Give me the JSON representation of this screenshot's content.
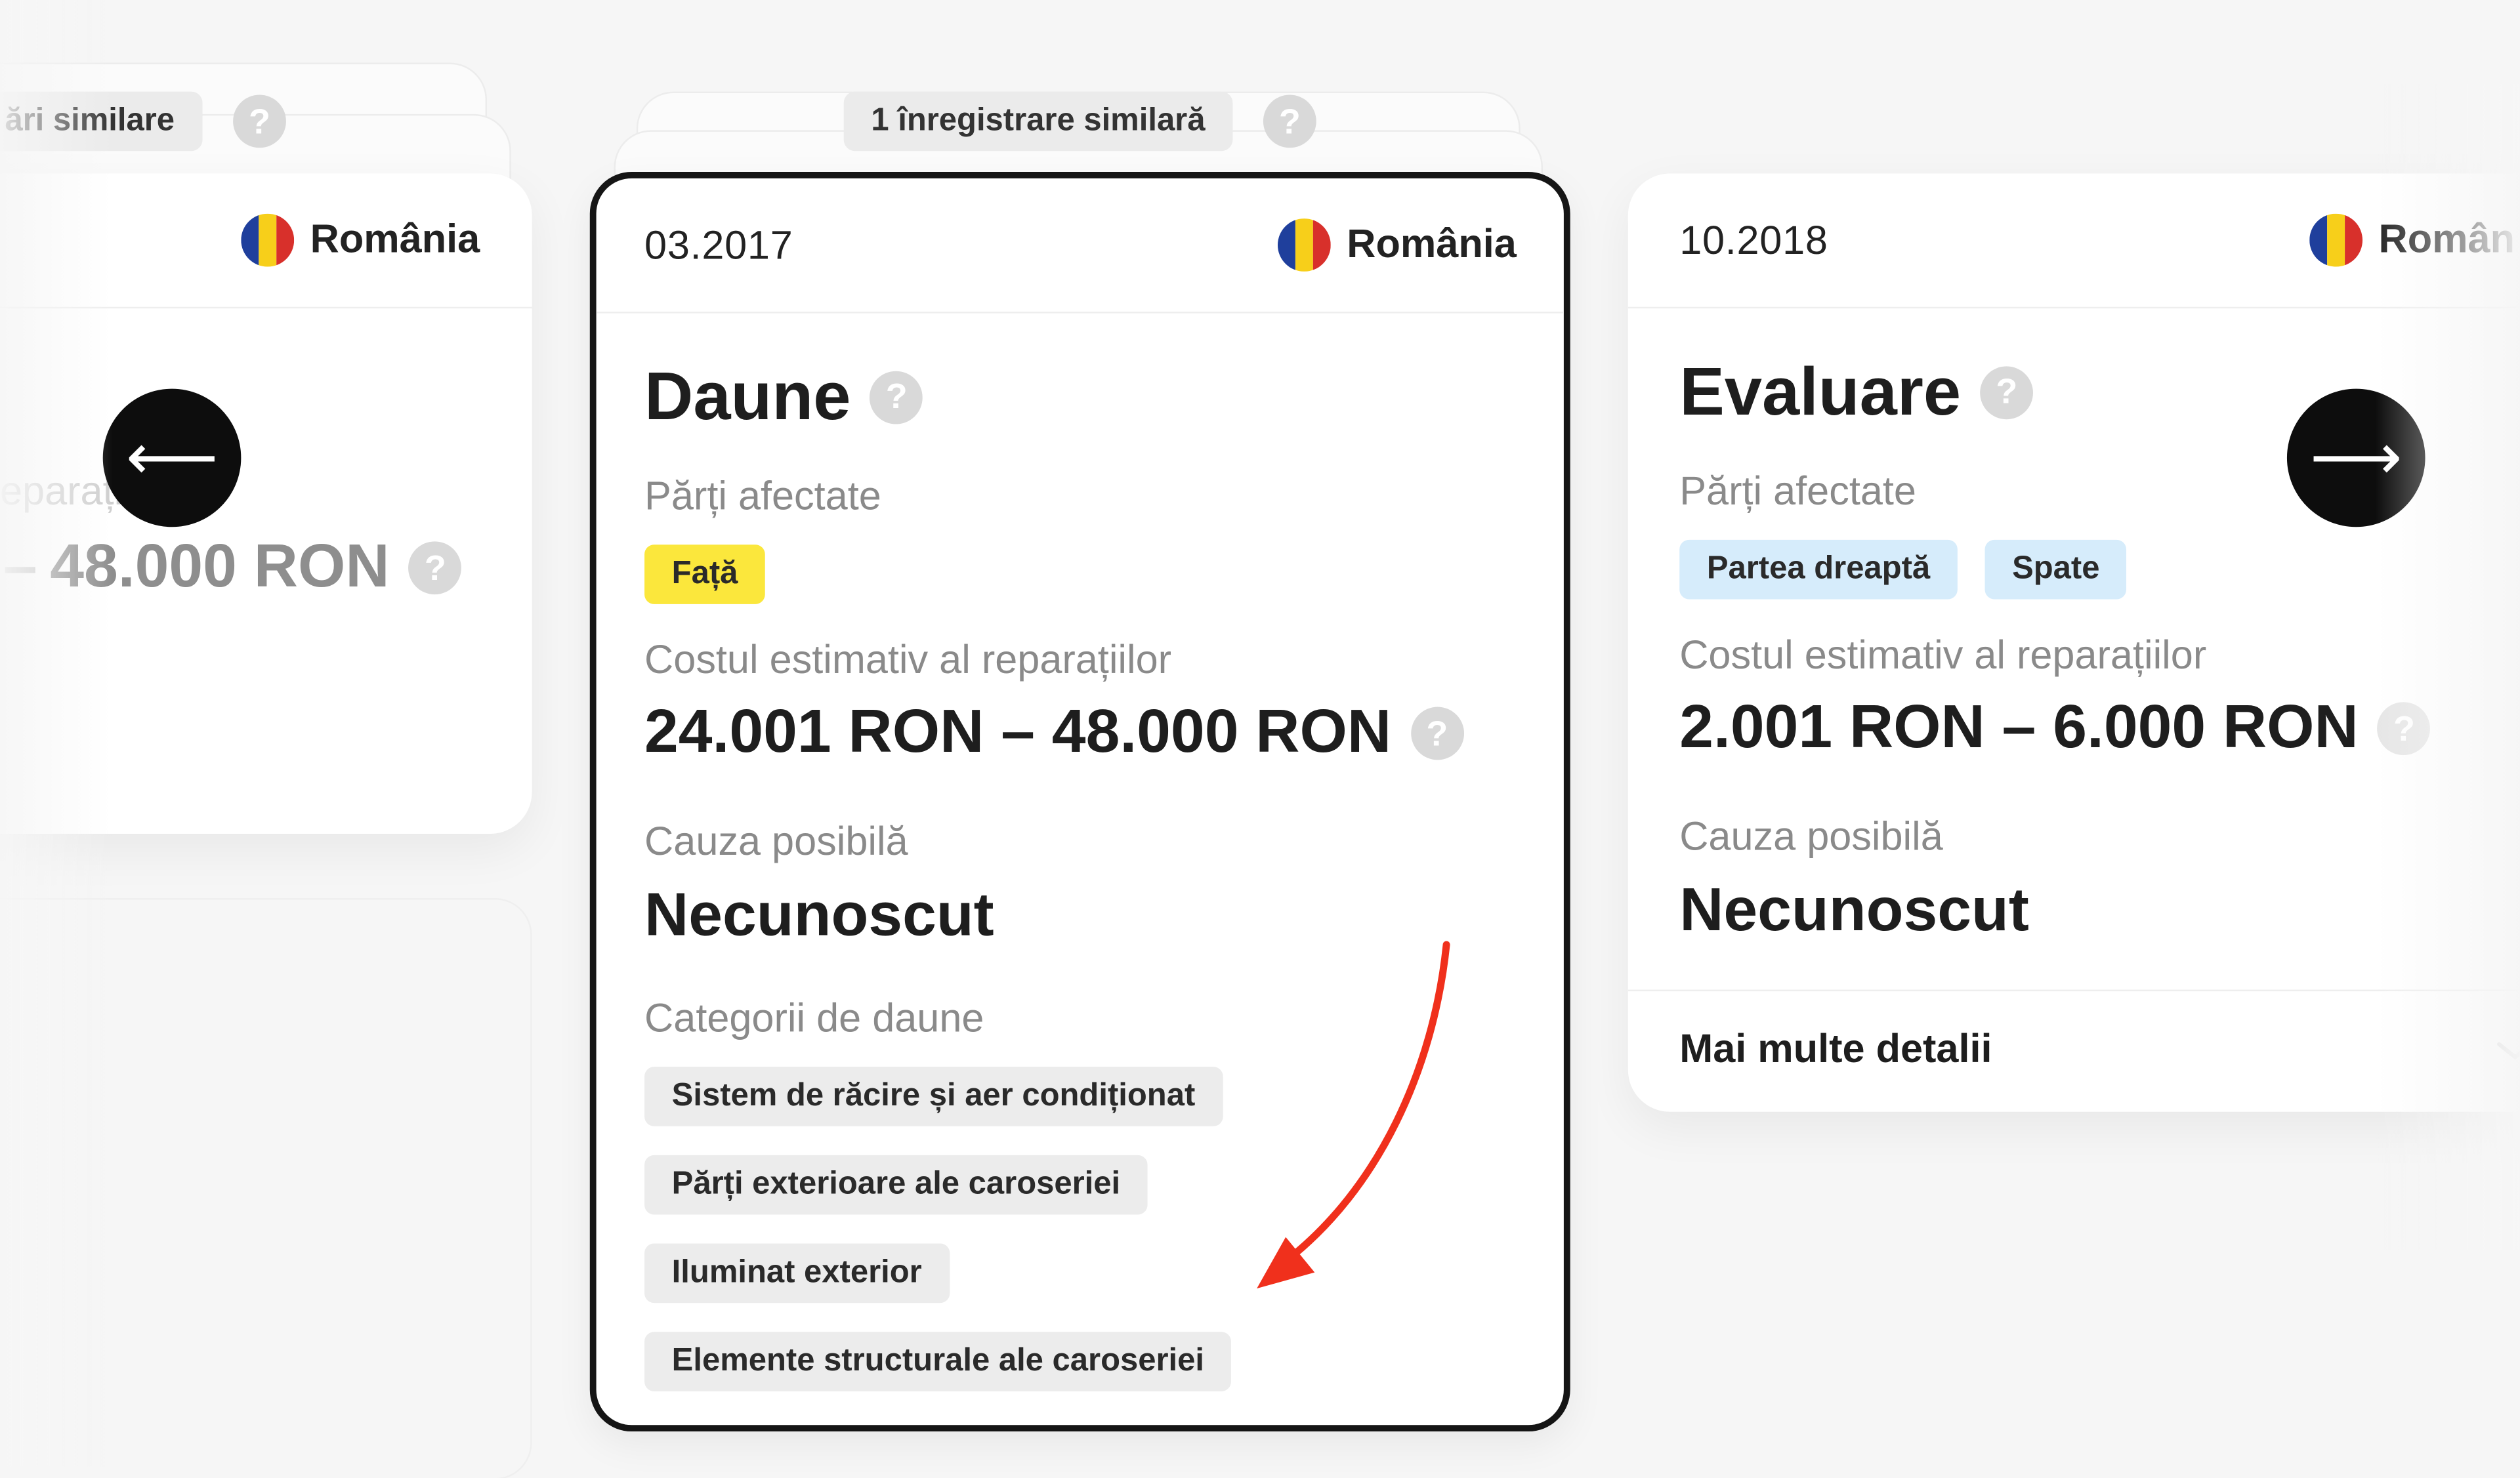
{
  "left_card": {
    "similar_label": "răr i similare",
    "similar_label_visible": "ări similare",
    "country": "România",
    "cost_label": "eparați",
    "cost_value": "48.000 RON"
  },
  "center_card": {
    "similar_label": "1 înregistrare similară",
    "date": "03.2017",
    "country": "România",
    "title": "Daune",
    "parts_label": "Părți afectate",
    "parts": [
      "Față"
    ],
    "cost_label": "Costul estimativ al reparațiilor",
    "cost_value": "24.001 RON – 48.000 RON",
    "cause_label": "Cauza posibilă",
    "cause_value": "Necunoscut",
    "categories_label": "Categorii de daune",
    "categories": [
      "Sistem de răcire și aer condiționat",
      "Părți exterioare ale caroseriei",
      "Iluminat exterior",
      "Elemente structurale ale caroseriei"
    ]
  },
  "right_card": {
    "date": "10.2018",
    "country": "Român",
    "title": "Evaluare",
    "parts_label": "Părți afectate",
    "parts": [
      "Partea dreaptă",
      "Spate"
    ],
    "cost_label": "Costul estimativ al reparațiilor",
    "cost_value": "2.001 RON – 6.000 RON",
    "cause_label": "Cauza posibilă",
    "cause_value": "Necunoscut",
    "more_details": "Mai multe detalii"
  },
  "icons": {
    "prev": "arrow-left-icon",
    "next": "arrow-right-icon",
    "help": "question-icon",
    "flag": "romania-flag-icon",
    "annotation": "red-arrow-annotation"
  },
  "colors": {
    "tag_yellow": "#fbe73c",
    "tag_blue": "#d6ecfb",
    "annotation_red": "#f0301c"
  },
  "help_glyph": "?",
  "prev_glyph": "⟵",
  "next_glyph": "⟶"
}
